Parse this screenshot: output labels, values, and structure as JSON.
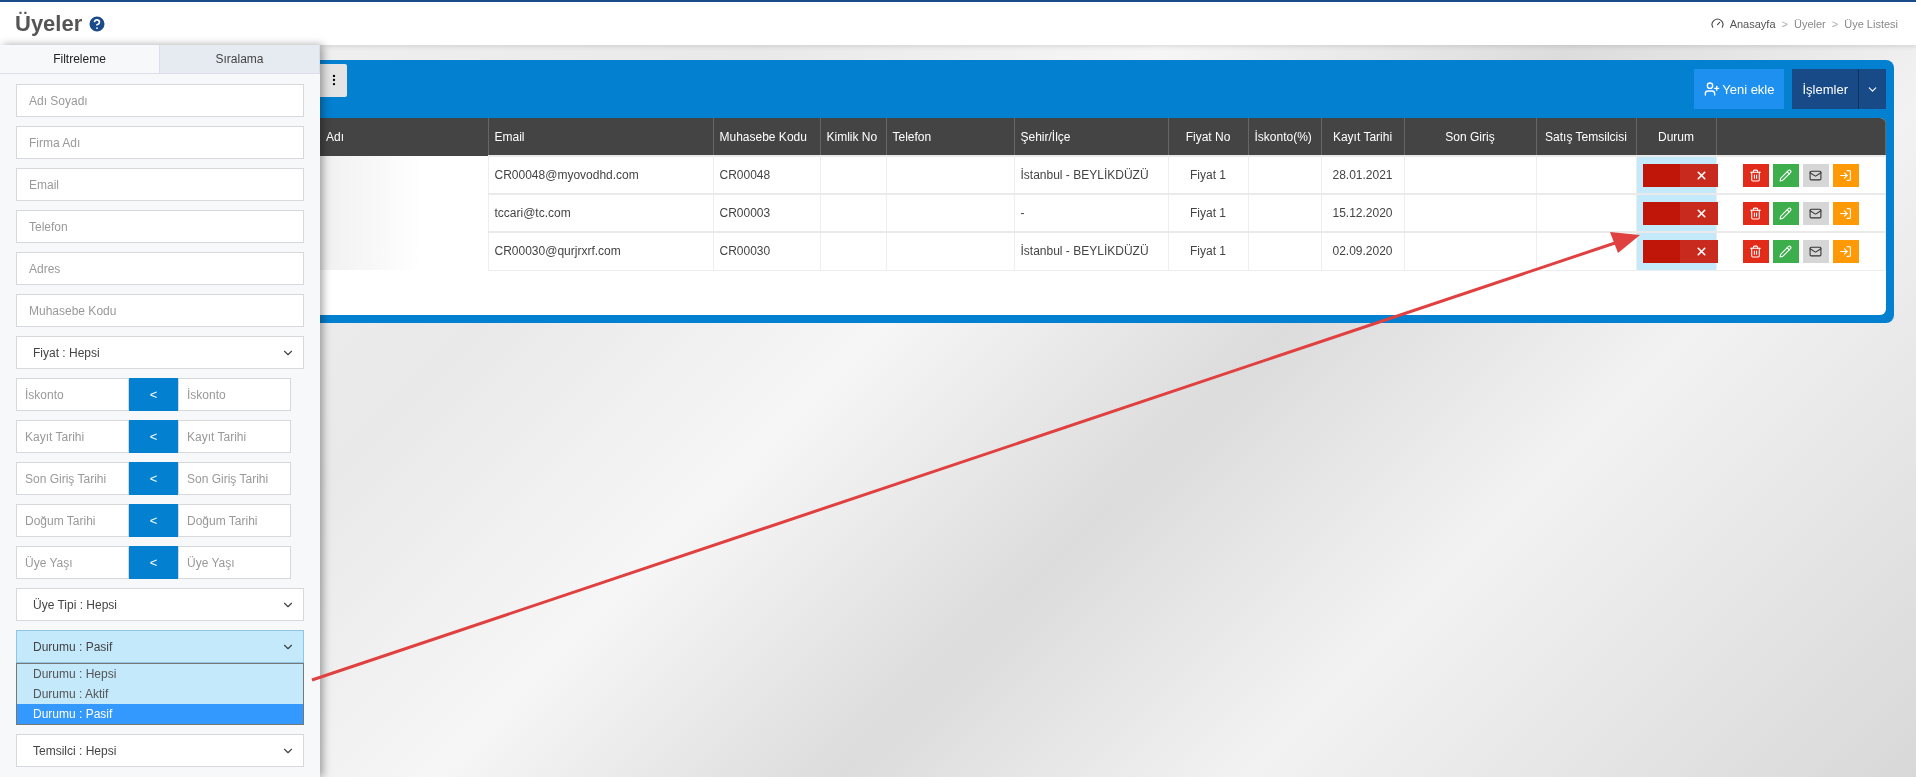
{
  "page": {
    "title": "Üyeler"
  },
  "breadcrumb": [
    {
      "label": "Anasayfa"
    },
    {
      "label": "Üyeler",
      "separator": ">"
    },
    {
      "label": "Üye Listesi",
      "separator": ">"
    }
  ],
  "filter_panel": {
    "tabs": [
      {
        "label": "Filtreleme",
        "selected": true
      },
      {
        "label": "Sıralama",
        "selected": false
      }
    ],
    "fields": [
      {
        "kind": "text",
        "placeholder": "Adı Soyadı"
      },
      {
        "kind": "text",
        "placeholder": "Firma Adı"
      },
      {
        "kind": "text",
        "placeholder": "Email"
      },
      {
        "kind": "text",
        "placeholder": "Telefon"
      },
      {
        "kind": "text",
        "placeholder": "Adres"
      },
      {
        "kind": "text",
        "placeholder": "Muhasebe Kodu"
      },
      {
        "kind": "select",
        "value": "Fiyat : Hepsi",
        "open": false
      },
      {
        "kind": "range",
        "from_placeholder": "İskonto",
        "operator": "<",
        "to_placeholder": "İskonto"
      },
      {
        "kind": "range",
        "from_placeholder": "Kayıt Tarihi",
        "operator": "<",
        "to_placeholder": "Kayıt Tarihi"
      },
      {
        "kind": "range",
        "from_placeholder": "Son Giriş Tarihi",
        "operator": "<",
        "to_placeholder": "Son Giriş Tarihi"
      },
      {
        "kind": "range",
        "from_placeholder": "Doğum Tarihi",
        "operator": "<",
        "to_placeholder": "Doğum Tarihi"
      },
      {
        "kind": "range",
        "from_placeholder": "Üye Yaşı",
        "operator": "<",
        "to_placeholder": "Üye Yaşı"
      },
      {
        "kind": "select",
        "value": "Üye Tipi : Hepsi",
        "open": false
      },
      {
        "kind": "select",
        "value": "Durumu : Pasif",
        "open": true,
        "options": [
          {
            "label": "Durumu : Hepsi",
            "selected": false
          },
          {
            "label": "Durumu : Aktif",
            "selected": false
          },
          {
            "label": "Durumu : Pasif",
            "selected": true
          }
        ]
      },
      {
        "kind": "select",
        "value": "Temsilci : Hepsi",
        "open": false
      }
    ]
  },
  "toolbar": {
    "buttons": [
      {
        "kind": "add",
        "label": "Yeni ekle"
      },
      {
        "kind": "menu",
        "label": "İşlemler"
      }
    ]
  },
  "table": {
    "columns": [
      {
        "label": "Adı",
        "highlighted": false
      },
      {
        "label": "Email",
        "highlighted": false
      },
      {
        "label": "Muhasebe Kodu",
        "highlighted": false
      },
      {
        "label": "Kimlik No",
        "highlighted": false
      },
      {
        "label": "Telefon",
        "highlighted": false
      },
      {
        "label": "Şehir/İlçe",
        "highlighted": false
      },
      {
        "label": "Fiyat No",
        "highlighted": false
      },
      {
        "label": "İskonto(%)",
        "highlighted": false
      },
      {
        "label": "Kayıt Tarihi",
        "highlighted": false
      },
      {
        "label": "Son Giriş",
        "highlighted": false
      },
      {
        "label": "Satış Temsilcisi",
        "highlighted": false
      },
      {
        "label": "Durum",
        "highlighted": true
      }
    ],
    "rows": [
      {
        "email": "CR00048@myovodhd.com",
        "muhasebe_kodu": "CR00048",
        "sehir": "İstanbul - BEYLİKDÜZÜ",
        "fiyat_no": "Fiyat 1",
        "kayit_tarihi": "28.01.2021",
        "active": false
      },
      {
        "email": "tccari@tc.com",
        "muhasebe_kodu": "CR00003",
        "sehir": "-",
        "fiyat_no": "Fiyat 1",
        "kayit_tarihi": "15.12.2020",
        "active": false
      },
      {
        "email": "CR00030@qurjrxrf.com",
        "muhasebe_kodu": "CR00030",
        "sehir": "İstanbul - BEYLİKDÜZÜ",
        "fiyat_no": "Fiyat 1",
        "kayit_tarihi": "02.09.2020",
        "active": false
      }
    ]
  }
}
